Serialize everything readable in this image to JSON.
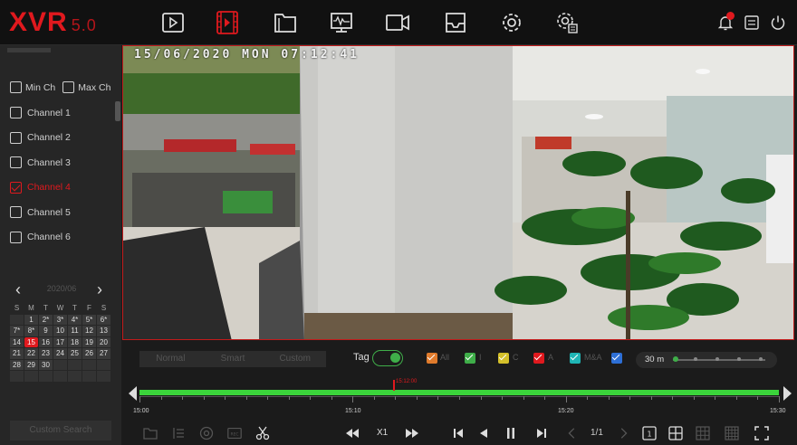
{
  "app": {
    "logo": "XVR",
    "version": "5.0"
  },
  "osd": {
    "timestamp": "15/06/2020 MON 07:12:41"
  },
  "sidebar": {
    "min_ch_label": "Min Ch",
    "max_ch_label": "Max Ch",
    "channels": [
      {
        "label": "Channel 1",
        "checked": false
      },
      {
        "label": "Channel 2",
        "checked": false
      },
      {
        "label": "Channel 3",
        "checked": false
      },
      {
        "label": "Channel 4",
        "checked": true
      },
      {
        "label": "Channel 5",
        "checked": false
      },
      {
        "label": "Channel 6",
        "checked": false
      }
    ],
    "calendar": {
      "title": "2020/06",
      "weekdays": [
        "S",
        "M",
        "T",
        "W",
        "T",
        "F",
        "S"
      ],
      "rows": [
        [
          "",
          "1",
          "2*",
          "3*",
          "4*",
          "5*",
          "6*"
        ],
        [
          "7*",
          "8*",
          "9",
          "10",
          "11",
          "12",
          "13"
        ],
        [
          "14",
          "15",
          "16",
          "17",
          "18",
          "19",
          "20"
        ],
        [
          "21",
          "22",
          "23",
          "24",
          "25",
          "26",
          "27"
        ],
        [
          "28",
          "29",
          "30",
          "",
          "",
          "",
          ""
        ],
        [
          "",
          "",
          "",
          "",
          "",
          "",
          ""
        ]
      ],
      "selected_day": "15"
    },
    "custom_search_label": "Custom Search"
  },
  "playback": {
    "mode_tabs": [
      "Normal",
      "Smart",
      "Custom"
    ],
    "tag_label": "Tag",
    "filters": [
      {
        "label": "All",
        "color": "#e07b2c"
      },
      {
        "label": "I",
        "color": "#3fae49"
      },
      {
        "label": "C",
        "color": "#d4c02a"
      },
      {
        "label": "A",
        "color": "#e0191e"
      },
      {
        "label": "M&A",
        "color": "#1fb5b5"
      },
      {
        "label": "",
        "color": "#2d6fd6"
      }
    ],
    "zoom_label": "30 m",
    "timeline": {
      "labels": [
        "15:00",
        "15:10",
        "15:20",
        "15:30"
      ],
      "cursor_label": "15:12:00"
    },
    "speed_label": "X1",
    "page_label": "1/1"
  },
  "colors": {
    "accent": "#e0191e",
    "record": "#3bd43b"
  }
}
